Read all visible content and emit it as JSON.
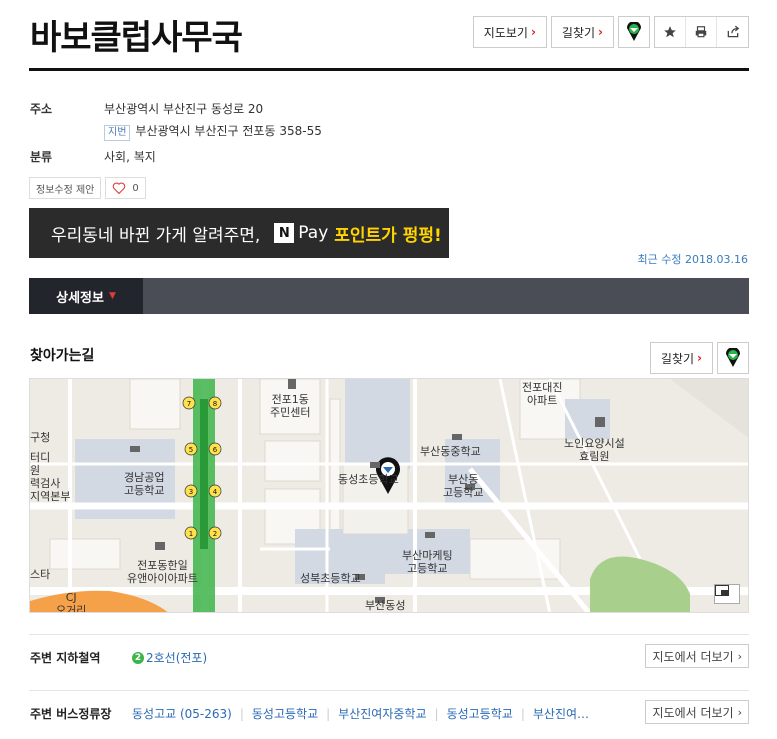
{
  "place": {
    "name": "바보클럽사무국",
    "address_label": "주소",
    "address": "부산광역시 부산진구 동성로 20",
    "jibun_tag": "지번",
    "jibun_address": "부산광역시 부산진구 전포동 358-55",
    "category_label": "분류",
    "category": "사회, 복지"
  },
  "actions": {
    "map_view": "지도보기",
    "directions": "길찾기",
    "chevron": "›",
    "edit_info": "정보수정 제안",
    "like_count": "0"
  },
  "banner": {
    "text": "우리동네 바뀐 가게 알려주면,",
    "npay_letter": "N",
    "pay": "Pay",
    "point": "포인트가 펑펑!"
  },
  "recent_update": "최근 수정 2018.03.16",
  "tabs": {
    "detail": "상세정보"
  },
  "route": {
    "title": "찾아가는길",
    "directions": "길찾기"
  },
  "map": {
    "labels": {
      "jeonpo1": "전포1동\n주민센터",
      "jeonpo_apt": "전포대진\n아파트",
      "senior": "노인요양시설\n효림원",
      "busan_dong_mid": "부산동중학교",
      "busan_dong_high": "부산동\n고등학교",
      "dongseong_elem": "동성초등학교",
      "gyeongnam": "경남공업\n고등학교",
      "marketing": "부산마케팅\n고등학교",
      "seongbuk": "성북초등학교",
      "jeonpo_hanil": "전포동한일\n유앤아이아파트",
      "busan_dongseong": "부산동성",
      "left_a": "구청",
      "left_b": "터디\n원\n력검사\n지역본부",
      "left_c": "스타",
      "cj": "CJ\n오거리",
      "exit_nums": [
        "7",
        "8",
        "5",
        "6",
        "3",
        "4",
        "1",
        "2"
      ]
    }
  },
  "subway": {
    "label": "주변 지하철역",
    "line_badge": "2",
    "station": "2호선(전포)",
    "more": "지도에서 더보기"
  },
  "bus": {
    "label": "주변 버스정류장",
    "stops": [
      "동성고교 (05-263)",
      "동성고등학교",
      "부산진여자중학교",
      "동성고등학교",
      "부산진여…"
    ],
    "more": "지도에서 더보기"
  }
}
